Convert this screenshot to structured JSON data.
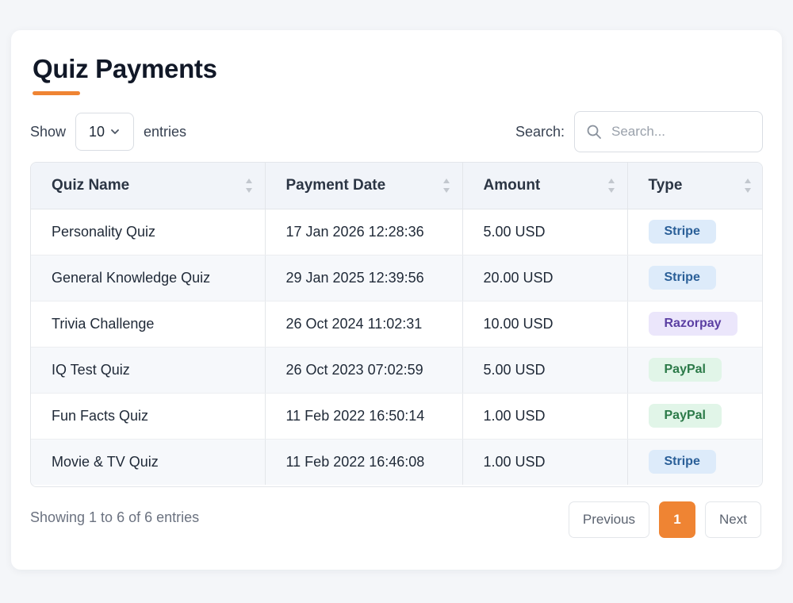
{
  "page": {
    "title": "Quiz Payments"
  },
  "controls": {
    "show_label": "Show",
    "entries_value": "10",
    "entries_label": "entries",
    "search_label": "Search:",
    "search_placeholder": "Search..."
  },
  "table": {
    "headers": [
      "Quiz Name",
      "Payment Date",
      "Amount",
      "Type"
    ],
    "rows": [
      {
        "quiz": "Personality Quiz",
        "date": "17 Jan 2026 12:28:36",
        "amount": "5.00 USD",
        "type": "Stripe"
      },
      {
        "quiz": "General Knowledge Quiz",
        "date": "29 Jan 2025 12:39:56",
        "amount": "20.00 USD",
        "type": "Stripe"
      },
      {
        "quiz": "Trivia Challenge",
        "date": "26 Oct 2024 11:02:31",
        "amount": "10.00 USD",
        "type": "Razorpay"
      },
      {
        "quiz": "IQ Test Quiz",
        "date": "26 Oct 2023 07:02:59",
        "amount": "5.00 USD",
        "type": "PayPal"
      },
      {
        "quiz": "Fun Facts Quiz",
        "date": "11 Feb 2022 16:50:14",
        "amount": "1.00 USD",
        "type": "PayPal"
      },
      {
        "quiz": "Movie & TV Quiz",
        "date": "11 Feb 2022 16:46:08",
        "amount": "1.00 USD",
        "type": "Stripe"
      }
    ]
  },
  "footer": {
    "info": "Showing 1 to 6 of 6 entries",
    "previous_label": "Previous",
    "current_page": "1",
    "next_label": "Next"
  },
  "colors": {
    "accent": "#ef8433",
    "stripe_badge": "#ddebfa",
    "razorpay_badge": "#ebe6fb",
    "paypal_badge": "#e1f5e8"
  },
  "icons": {
    "entries_dropdown": "chevron-down-icon",
    "search": "search-icon",
    "sort": "sort-icon"
  }
}
